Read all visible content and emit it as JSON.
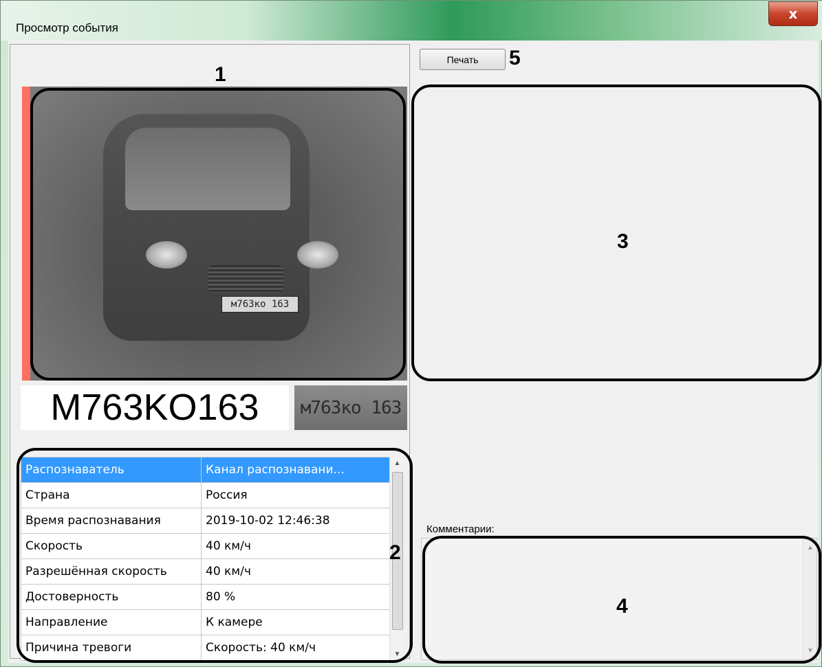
{
  "window": {
    "title": "Просмотр события",
    "close_label": "x"
  },
  "callouts": {
    "photo": "1",
    "table": "2",
    "image_area": "3",
    "comments": "4",
    "print": "5"
  },
  "recognition": {
    "plate_text": "M763KO163",
    "plate_on_car": "м763ко 163",
    "plate_crop": "м763ко 163"
  },
  "properties": {
    "rows": [
      {
        "name": "Распознаватель",
        "value": "Канал распознавани...",
        "selected": true
      },
      {
        "name": "Страна",
        "value": "Россия"
      },
      {
        "name": "Время распознавания",
        "value": "2019-10-02 12:46:38"
      },
      {
        "name": "Скорость",
        "value": "40 км/ч"
      },
      {
        "name": "Разрешённая скорость",
        "value": "40 км/ч"
      },
      {
        "name": "Достоверность",
        "value": "80 %"
      },
      {
        "name": "Направление",
        "value": "К камере"
      },
      {
        "name": "Причина тревоги",
        "value": "Скорость: 40 км/ч"
      }
    ]
  },
  "toolbar": {
    "print_label": "Печать"
  },
  "comments": {
    "label": "Комментарии:",
    "value": ""
  },
  "colors": {
    "selection": "#3399ff",
    "close_button": "#c9452c"
  }
}
